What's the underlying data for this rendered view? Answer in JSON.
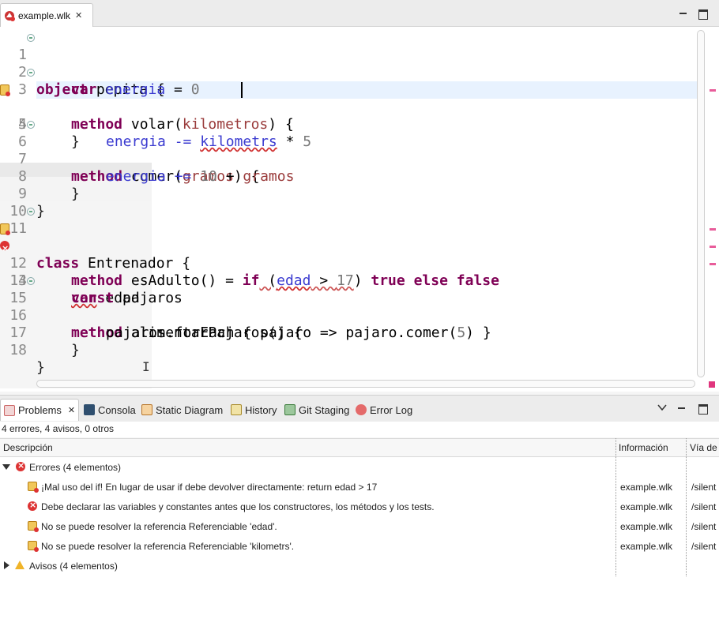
{
  "editor": {
    "tab_title": "example.wlk",
    "tab_close": "✕",
    "lines": [
      {
        "n": "1"
      },
      {
        "n": "2"
      },
      {
        "n": "3"
      },
      {
        "n": "4"
      },
      {
        "n": "5"
      },
      {
        "n": "6"
      },
      {
        "n": "7"
      },
      {
        "n": "8"
      },
      {
        "n": "9"
      },
      {
        "n": "10"
      },
      {
        "n": "11"
      },
      {
        "n": "12"
      },
      {
        "n": "13"
      },
      {
        "n": "14"
      },
      {
        "n": "15"
      },
      {
        "n": "16"
      },
      {
        "n": "17"
      },
      {
        "n": "18"
      }
    ],
    "code": {
      "l1": {
        "kw": "object",
        "name": " pepita {"
      },
      "l2": {
        "kw": "var",
        "name": " energia",
        "op": " = ",
        "num": "0"
      },
      "l3": {
        "kw": "method",
        "name": " volar(",
        "param": "kilometros",
        "rest": ") {"
      },
      "l4": {
        "name": "energia -= ",
        "err": "kilometrs",
        "op": " * ",
        "num": "5"
      },
      "l5": {
        "text": "}"
      },
      "l6": {
        "kw": "method",
        "name": " comer(",
        "param": "gramos",
        "rest": ") {"
      },
      "l7": {
        "name": "energia += ",
        "num": "10",
        "op": " + ",
        "param": "gramos"
      },
      "l8": {
        "text": "}"
      },
      "l9": {
        "text": "}"
      },
      "l10": {
        "text": ""
      },
      "l11": {
        "kw": "class",
        "name": " Entrenador {"
      },
      "l12": {
        "kw": "method",
        "name": " esAdulto() = ",
        "kw2": "if",
        "p1": " (",
        "err": "edad",
        "op": " > ",
        "num": "17",
        "p2": ") ",
        "kw3": "true",
        "sp": " ",
        "kw4": "else",
        "sp2": " ",
        "kw5": "false"
      },
      "l13": {
        "kw": "var",
        "name": " edad"
      },
      "l14": {
        "kw": "const",
        "name": " pajaros"
      },
      "l15": {
        "kw": "method",
        "name": " alimentarPajaros() {"
      },
      "l16": {
        "name": "pajaros.forEach { pajaro => pajaro.comer(",
        "num": "5",
        "rest": ") }"
      },
      "l17": {
        "text": "}"
      },
      "l18": {
        "text": "}"
      }
    }
  },
  "panel": {
    "tabs": [
      {
        "label": "Problems",
        "icon": "problems-icon"
      },
      {
        "label": "Consola",
        "icon": "console-icon"
      },
      {
        "label": "Static Diagram",
        "icon": "diagram-icon"
      },
      {
        "label": "History",
        "icon": "history-icon"
      },
      {
        "label": "Git Staging",
        "icon": "git-staging-icon"
      },
      {
        "label": "Error Log",
        "icon": "error-log-icon"
      }
    ],
    "close": "✕",
    "summary": "4 errores, 4 avisos, 0 otros",
    "columns": [
      "Descripción",
      "Información",
      "Vía de"
    ],
    "errors_group": "Errores (4 elementos)",
    "warnings_group": "Avisos (4 elementos)",
    "rows": [
      {
        "desc": "¡Mal uso del if! En lugar de usar if debe devolver directamente:   return edad > 17",
        "resource": "example.wlk",
        "path": "/silent",
        "icon": "error-warning-icon"
      },
      {
        "desc": "Debe declarar las variables y constantes antes que los constructores, los métodos y los tests.",
        "resource": "example.wlk",
        "path": "/silent",
        "icon": "error-icon"
      },
      {
        "desc": "No se puede resolver la referencia Referenciable 'edad'.",
        "resource": "example.wlk",
        "path": "/silent",
        "icon": "error-warning-icon"
      },
      {
        "desc": "No se puede resolver la referencia Referenciable 'kilometrs'.",
        "resource": "example.wlk",
        "path": "/silent",
        "icon": "error-warning-icon"
      }
    ]
  },
  "colors": {
    "keyword": "#7f0055",
    "error": "#d33333",
    "warning": "#f0b429",
    "highlight": "#e8f2fe"
  }
}
